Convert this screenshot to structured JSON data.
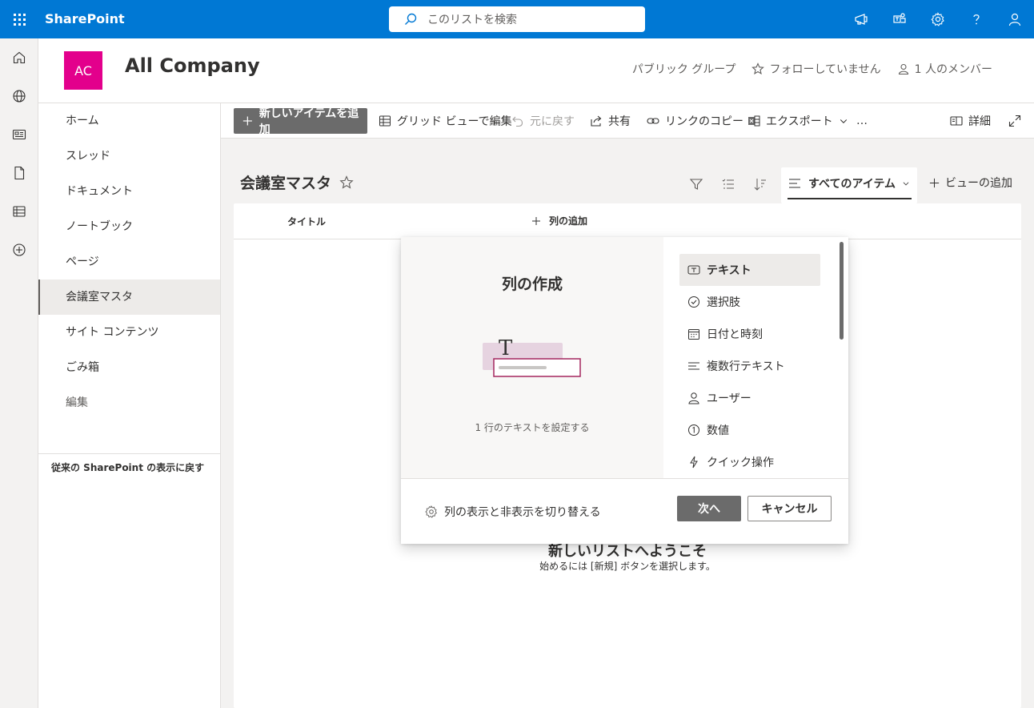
{
  "suitebar": {
    "brand": "SharePoint",
    "search_placeholder": "このリストを検索",
    "icons": [
      "megaphone-icon",
      "teams-chat-icon",
      "gear-icon",
      "help-icon",
      "person-icon"
    ]
  },
  "rail": {
    "icons": [
      "home-icon",
      "globe-icon",
      "news-icon",
      "document-icon",
      "list-icon",
      "add-circle-icon"
    ]
  },
  "site": {
    "logo_initials": "AC",
    "logo_color": "#e3008c",
    "title": "All Company",
    "privacy": "パブリック グループ",
    "follow": "フォローしていません",
    "members": "1 人のメンバー"
  },
  "leftnav": {
    "items": [
      {
        "label": "ホーム"
      },
      {
        "label": "スレッド"
      },
      {
        "label": "ドキュメント"
      },
      {
        "label": "ノートブック"
      },
      {
        "label": "ページ"
      },
      {
        "label": "会議室マスタ",
        "active": true
      },
      {
        "label": "サイト コンテンツ"
      },
      {
        "label": "ごみ箱"
      },
      {
        "label": "編集"
      }
    ],
    "revert": "従来の SharePoint の表示に戻す"
  },
  "commandbar": {
    "new_item": "新しいアイテムを追加",
    "grid_edit": "グリッド ビューで編集",
    "undo": "元に戻す",
    "share": "共有",
    "copy_link": "リンクのコピー",
    "export": "エクスポート",
    "more": "…",
    "details": "詳細"
  },
  "list": {
    "title": "会議室マスタ",
    "view_name": "すべてのアイテム",
    "add_view": "ビューの追加",
    "column_title": "タイトル",
    "add_column": "列の追加",
    "empty_title": "新しいリストへようこそ",
    "empty_subtitle": "始めるには [新規] ボタンを選択します。"
  },
  "dialog": {
    "heading": "列の作成",
    "description": "1 行のテキストを設定する",
    "types": [
      {
        "label": "テキスト",
        "icon": "text-box-icon",
        "selected": true
      },
      {
        "label": "選択肢",
        "icon": "check-circle-icon"
      },
      {
        "label": "日付と時刻",
        "icon": "calendar-icon"
      },
      {
        "label": "複数行テキスト",
        "icon": "multiline-text-icon"
      },
      {
        "label": "ユーザー",
        "icon": "person-icon"
      },
      {
        "label": "数値",
        "icon": "number-circle-icon"
      },
      {
        "label": "クイック操作",
        "icon": "flash-icon"
      }
    ],
    "toggle_columns": "列の表示と非表示を切り替える",
    "next": "次へ",
    "cancel": "キャンセル"
  },
  "colors": {
    "suitebar": "#0078d4",
    "accent_button": "#6b6b6b"
  }
}
